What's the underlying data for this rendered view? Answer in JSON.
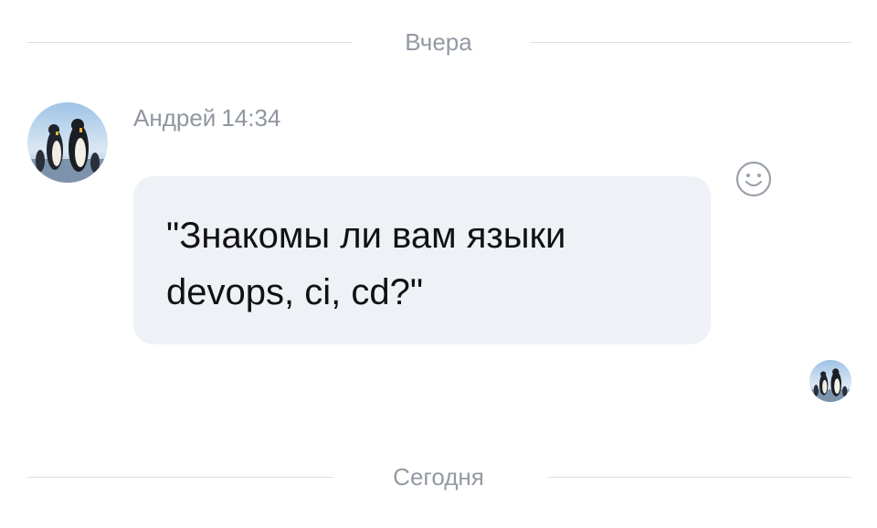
{
  "separators": {
    "top_label": "Вчера",
    "bottom_label": "Сегодня"
  },
  "message": {
    "author": "Андрей",
    "time": "14:34",
    "text_line1": "\"Знакомы ли вам языки",
    "text_line2": "devops, ci, cd?\""
  },
  "icons": {
    "avatar": "penguins-avatar-icon",
    "reaction": "smiley-icon",
    "read_receipt": "penguins-avatar-icon"
  },
  "colors": {
    "bubble": "#eef1f6",
    "meta_text": "#8f96a0",
    "separator_line": "#dcdfe3"
  }
}
